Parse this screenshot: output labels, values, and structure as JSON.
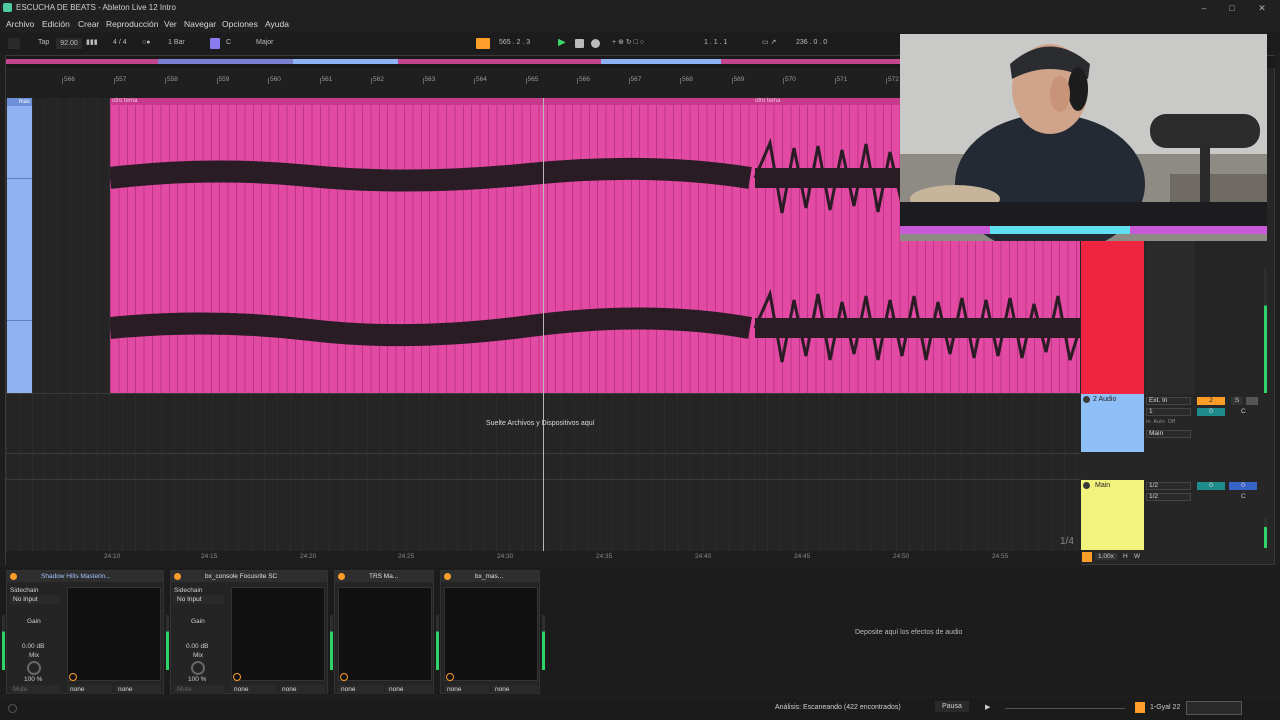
{
  "window": {
    "title": "ESCUCHA DE BEATS - Ableton Live 12 Intro"
  },
  "menu": [
    "Archivo",
    "Edición",
    "Crear",
    "Reproducción",
    "Ver",
    "Navegar",
    "Opciones",
    "Ayuda"
  ],
  "toolbar": {
    "tap": "Tap",
    "tempo": "92.00",
    "signature": "4 / 4",
    "quantize": "1 Bar",
    "key": "C",
    "scale": "Major",
    "position": "565 .  2 .  3",
    "loop_start": "1 .  1 .  1",
    "loop_length": "236 .  0 .  0"
  },
  "ruler": {
    "bars": [
      "566",
      "557",
      "558",
      "559",
      "560",
      "561",
      "562",
      "563",
      "564",
      "565",
      "566",
      "567",
      "568",
      "569",
      "570",
      "571",
      "572"
    ]
  },
  "clips": {
    "left_clip": "mas",
    "clip_a": "otro tema",
    "clip_b": "otro tema"
  },
  "drop_message": "Suelte Archivos y Dispositivos aquí",
  "timeline": [
    "24:10",
    "24:15",
    "24:20",
    "24:25",
    "24:30",
    "24:35",
    "24:40",
    "24:45",
    "24:50",
    "24:55"
  ],
  "fraction": "1/4",
  "tracks": {
    "audio2": {
      "name": "2 Audio",
      "input": "Ext. In",
      "channel": "1",
      "monitor": [
        "In",
        "Auto",
        "Off"
      ],
      "output": "Main",
      "track_num": "2",
      "solo": "S",
      "pan": "C",
      "vol": "0"
    },
    "main": {
      "name": "Main",
      "in1": "1/2",
      "in2": "1/2",
      "vol": "0",
      "send": "0",
      "pan": "C"
    },
    "mixer_footer": {
      "zoom": "1.00x",
      "h": "H",
      "w": "W"
    }
  },
  "devices": [
    {
      "name": "Shadow Hills Masterin...",
      "sidechain": "Sidechain",
      "sidechain_value": "No Input",
      "gain_label": "Gain",
      "gain_value": "0.00 dB",
      "mix_label": "Mix",
      "mix_value": "100 %",
      "mute": "Mute",
      "sel1": "none",
      "sel2": "none"
    },
    {
      "name": "bx_console Focusrite SC",
      "sidechain": "Sidechain",
      "sidechain_value": "No Input",
      "gain_label": "Gain",
      "gain_value": "0.00 dB",
      "mix_label": "Mix",
      "mix_value": "100 %",
      "mute": "Mute",
      "sel1": "none",
      "sel2": "none"
    },
    {
      "name": "TRS Ma...",
      "sel1": "none",
      "sel2": "none"
    },
    {
      "name": "bx_mas...",
      "sel1": "none",
      "sel2": "none"
    }
  ],
  "device_drop": "Deposite aquí los efectos de audio",
  "status": {
    "analysis": "Análisis: Escaneando (422 encontrados)",
    "pause": "Pausa",
    "track": "1-Gyal 22"
  },
  "colors": {
    "clip": "#e24aa3",
    "clip_strip": "#c73a8b",
    "track1": "#ef2440",
    "track2": "#8fbff7",
    "main": "#f2f37d",
    "accent": "#ff9d2b"
  }
}
